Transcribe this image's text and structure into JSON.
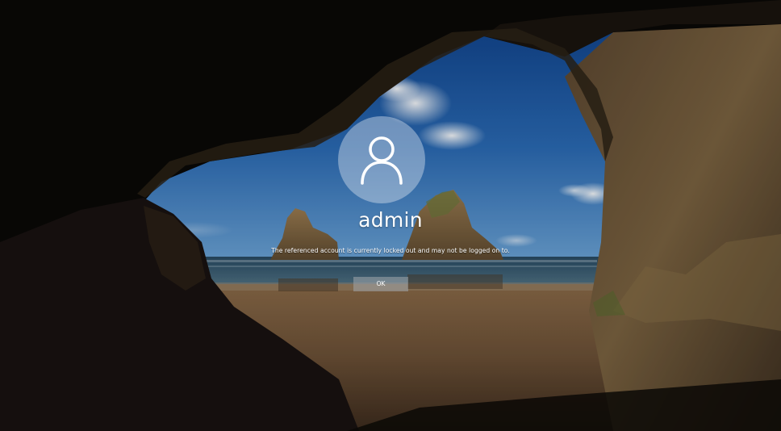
{
  "lock_screen": {
    "username": "admin",
    "message": "The referenced account is currently locked out and may not be logged on to.",
    "ok_label": "OK",
    "avatar_icon": "user-icon",
    "text_color": "#ffffff"
  }
}
